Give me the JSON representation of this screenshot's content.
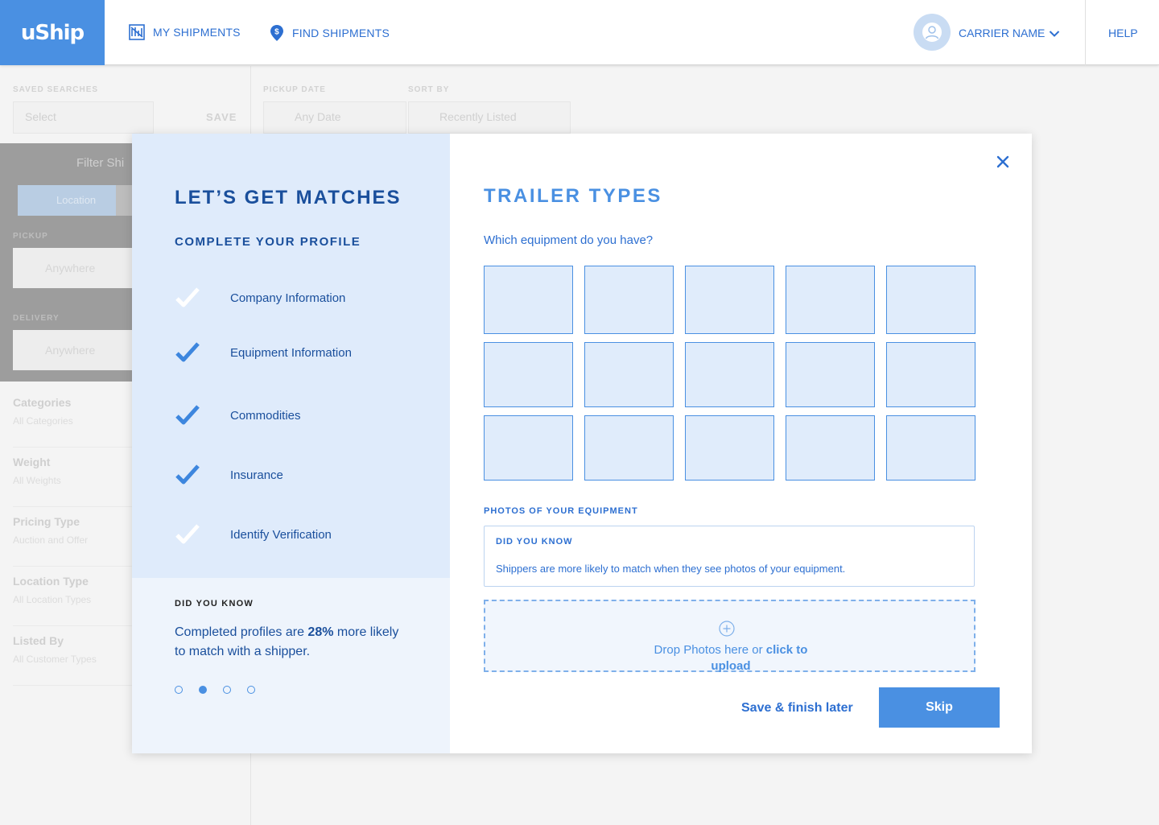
{
  "nav": {
    "logo": "uShip",
    "my_shipments": "MY SHIPMENTS",
    "find_shipments": "FIND SHIPMENTS",
    "carrier_name": "CARRIER NAME",
    "help": "HELP"
  },
  "background": {
    "saved_searches_label": "SAVED SEARCHES",
    "saved_select": "Select",
    "save": "SAVE",
    "pickup_date_label": "PICKUP DATE",
    "pickup_date_value": "Any Date",
    "sort_by_label": "SORT BY",
    "sort_by_value": "Recently Listed",
    "filter_title": "Filter Shi",
    "location_tab": "Location",
    "pickup_label": "PICKUP",
    "pickup_value": "Anywhere",
    "delivery_label": "DELIVERY",
    "delivery_value": "Anywhere",
    "filters": [
      {
        "title": "Categories",
        "sub": "All Categories"
      },
      {
        "title": "Weight",
        "sub": "All Weights"
      },
      {
        "title": "Pricing Type",
        "sub": "Auction and Offer"
      },
      {
        "title": "Location Type",
        "sub": "All Location Types"
      },
      {
        "title": "Listed By",
        "sub": "All Customer Types"
      }
    ]
  },
  "modal": {
    "left": {
      "title": "LET’S GET MATCHES",
      "subtitle": "COMPLETE YOUR PROFILE",
      "steps": [
        {
          "label": "Company Information",
          "done": false
        },
        {
          "label": "Equipment Information",
          "done": true
        },
        {
          "label": "Commodities",
          "done": true
        },
        {
          "label": "Insurance",
          "done": true
        },
        {
          "label": "Identify Verification",
          "done": false
        }
      ],
      "did_you_know_label": "DID YOU KNOW",
      "did_you_know_pre": "Completed profiles are ",
      "did_you_know_bold": "28%",
      "did_you_know_post": " more likely to match with a shipper.",
      "pager": {
        "count": 4,
        "active": 2
      }
    },
    "right": {
      "title": "TRAILER TYPES",
      "question": "Which equipment do you have?",
      "photos_label": "PHOTOS OF YOUR EQUIPMENT",
      "tip_label": "DID YOU KNOW",
      "tip_text": "Shippers are more likely to match when they see photos of your equipment.",
      "drop_pre": "Drop Photos here or ",
      "drop_link": "click to upload",
      "save_later": "Save & finish later",
      "skip": "Skip"
    }
  },
  "colors": {
    "brand": "#4a90e2",
    "navy": "#1a4f9c",
    "tile_fill": "#e0ecfb",
    "left_panel": "#dfebfb",
    "check_done": "#3d86de",
    "check_todo": "#ffffff"
  },
  "icons": {
    "my_shipments": "shipments-grid-icon",
    "find_shipments": "map-pin-dollar-icon",
    "avatar": "user-avatar-icon",
    "dropdown": "chevron-down-icon",
    "close": "close-icon",
    "check": "checkmark-icon",
    "upload": "plus-circle-icon"
  }
}
